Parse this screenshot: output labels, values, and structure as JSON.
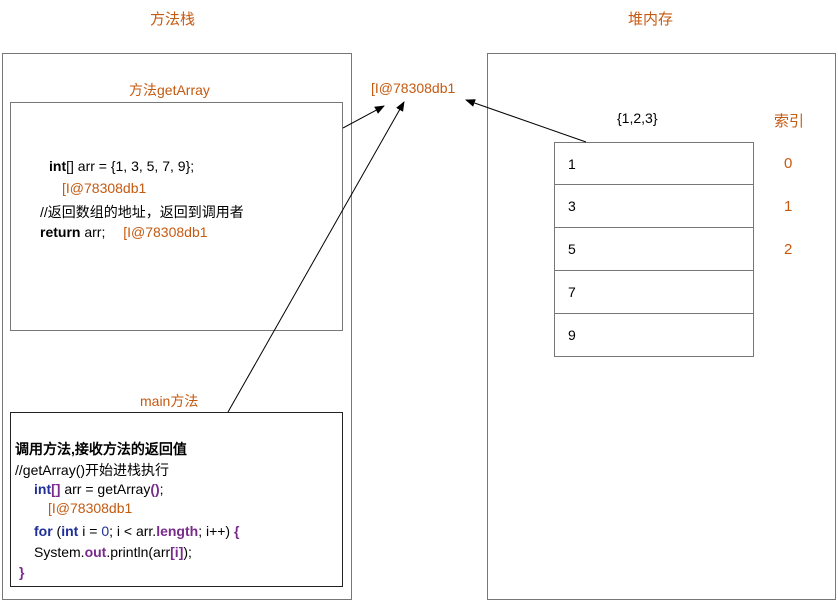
{
  "titles": {
    "method_stack": "方法栈",
    "heap": "堆内存"
  },
  "getArray_frame": {
    "label": "方法getArray",
    "lines": {
      "decl_kw": "int",
      "decl_rest": "[] arr = {1, 3, 5, 7, 9};",
      "addr1": "[I@78308db1",
      "comment": "//返回数组的地址，返回到调用者",
      "ret_kw": "return",
      "ret_rest": " arr;",
      "addr2": "[I@78308db1"
    }
  },
  "main_frame": {
    "label": "main方法",
    "lines": {
      "l1": "调用方法,接收方法的返回值",
      "l2": "//getArray()开始进栈执行",
      "l3_kw": "int",
      "l3_b1": "[",
      "l3_b2": "]",
      "l3_rest": " arr = getArray",
      "l3_paren": "()",
      "l3_end": ";",
      "addr": "[I@78308db1",
      "l5_for": "for",
      "l5_open": " (",
      "l5_int": "int",
      "l5_mid": " i = ",
      "l5_zero": "0",
      "l5_mid2": "; i < arr.",
      "l5_length": "length",
      "l5_end": "; i++) ",
      "l5_brace": "{",
      "l6_a": "System.",
      "l6_out": "out",
      "l6_b": ".println(arr",
      "l6_idx": "[i]",
      "l6_c": ");",
      "l7": "}"
    }
  },
  "address_label": "[I@78308db1",
  "heap": {
    "array_literal": "{1,2,3}",
    "index_header": "索引",
    "cells": [
      "1",
      "3",
      "5",
      "7",
      "9"
    ],
    "indices": [
      "0",
      "1",
      "2"
    ]
  },
  "colors": {
    "accent": "#c55a11",
    "keyword_blue": "#1f2f9a",
    "keyword_purple": "#7a2a8c",
    "border": "#777777"
  }
}
